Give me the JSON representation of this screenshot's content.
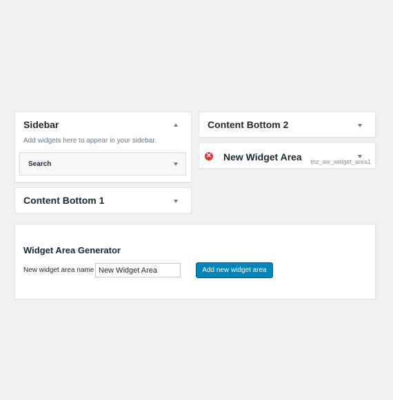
{
  "sidebar": {
    "title": "Sidebar",
    "description": "Add widgets here to appear in your sidebar.",
    "widgets": [
      {
        "label": "Search"
      }
    ]
  },
  "content_bottom_1": {
    "title": "Content Bottom 1"
  },
  "content_bottom_2": {
    "title": "Content Bottom 2"
  },
  "new_widget_area": {
    "title": "New Widget Area",
    "id": "thz_aw_widget_area1"
  },
  "generator": {
    "title": "Widget Area Generator",
    "name_label": "New widget area name",
    "name_value": "New Widget Area",
    "add_button": "Add new widget area"
  },
  "colors": {
    "background": "#f1f1f1",
    "primary_button": "#0085ba",
    "delete_icon": "#dc3232"
  }
}
